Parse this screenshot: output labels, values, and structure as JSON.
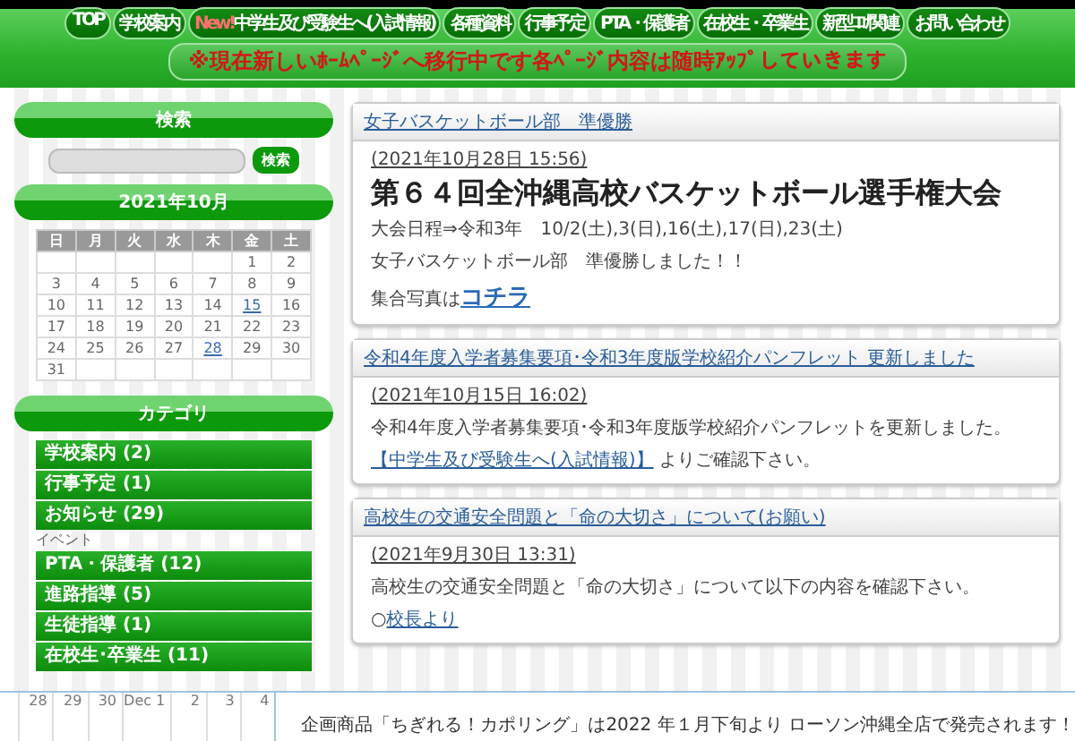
{
  "nav": [
    {
      "label": "TOP"
    },
    {
      "label": "学校案内"
    },
    {
      "badge": "New!",
      "label": "中学生及び受験生へ(入試情報)"
    },
    {
      "label": "各種資料"
    },
    {
      "label": "行事予定"
    },
    {
      "label": "PTA・保護者"
    },
    {
      "label": "在校生・卒業生"
    },
    {
      "label": "新型ｺﾛﾅ関連"
    },
    {
      "label": "お問い合わせ"
    }
  ],
  "notice": "※現在新しいﾎｰﾑﾍﾟｰｼﾞへ移行中です各ﾍﾟｰｼﾞ内容は随時ｱｯﾌﾟしていきます",
  "sidebar": {
    "search": {
      "title": "検索",
      "button": "検索"
    },
    "calendar": {
      "title": "2021年10月",
      "weekdays": [
        "日",
        "月",
        "火",
        "水",
        "木",
        "金",
        "土"
      ],
      "weeks": [
        [
          {
            "day": "1",
            "linked": false
          },
          {
            "day": "2",
            "linked": false
          }
        ],
        [
          {
            "day": "3",
            "linked": false
          },
          {
            "day": "4",
            "linked": false
          },
          {
            "day": "5",
            "linked": false
          },
          {
            "day": "6",
            "linked": false
          },
          {
            "day": "7",
            "linked": false
          },
          {
            "day": "8",
            "linked": false
          },
          {
            "day": "9",
            "linked": false
          }
        ],
        [
          {
            "day": "10",
            "linked": false
          },
          {
            "day": "11",
            "linked": false
          },
          {
            "day": "12",
            "linked": false
          },
          {
            "day": "13",
            "linked": false
          },
          {
            "day": "14",
            "linked": false
          },
          {
            "day": "15",
            "linked": true
          },
          {
            "day": "16",
            "linked": false
          }
        ],
        [
          {
            "day": "17",
            "linked": false
          },
          {
            "day": "18",
            "linked": false
          },
          {
            "day": "19",
            "linked": false
          },
          {
            "day": "20",
            "linked": false
          },
          {
            "day": "21",
            "linked": false
          },
          {
            "day": "22",
            "linked": false
          },
          {
            "day": "23",
            "linked": false
          }
        ],
        [
          {
            "day": "24",
            "linked": false
          },
          {
            "day": "25",
            "linked": false
          },
          {
            "day": "26",
            "linked": false
          },
          {
            "day": "27",
            "linked": false
          },
          {
            "day": "28",
            "linked": true
          },
          {
            "day": "29",
            "linked": false
          },
          {
            "day": "30",
            "linked": false
          }
        ],
        [
          {
            "day": "31",
            "linked": false
          }
        ]
      ]
    },
    "categories": {
      "title": "カテゴリ",
      "items": [
        {
          "kind": "button",
          "label": "学校案内 (2)"
        },
        {
          "kind": "button",
          "label": "行事予定 (1)"
        },
        {
          "kind": "button",
          "label": "お知らせ (29)"
        },
        {
          "kind": "plain",
          "label": "イベント"
        },
        {
          "kind": "button",
          "label": "PTA・保護者 (12)"
        },
        {
          "kind": "button",
          "label": "進路指導 (5)"
        },
        {
          "kind": "button",
          "label": "生徒指導 (1)"
        },
        {
          "kind": "button",
          "label": "在校生･卒業生 (11)"
        }
      ]
    }
  },
  "articles": [
    {
      "title": "女子バスケットボール部　準優勝",
      "date": "(2021年10月28日 15:56)",
      "body": [
        {
          "kind": "heading",
          "parts": [
            {
              "kind": "text",
              "text": "第６４回全沖縄高校バスケットボール選手権大会"
            }
          ]
        },
        {
          "kind": "text",
          "parts": [
            {
              "kind": "text",
              "text": "大会日程⇒令和3年　10/2(土),3(日),16(土),17(日),23(土)"
            }
          ]
        },
        {
          "kind": "text",
          "parts": [
            {
              "kind": "text",
              "text": "女子バスケットボール部　準優勝しました！！"
            }
          ]
        },
        {
          "kind": "text",
          "parts": [
            {
              "kind": "text",
              "text": "集合写真は"
            },
            {
              "kind": "big-link",
              "text": "コチラ"
            }
          ]
        }
      ]
    },
    {
      "title": "令和4年度入学者募集要項･令和3年度版学校紹介パンフレット 更新しました",
      "date": "(2021年10月15日 16:02)",
      "body": [
        {
          "kind": "text",
          "parts": [
            {
              "kind": "text",
              "text": "令和4年度入学者募集要項･令和3年度版学校紹介パンフレットを更新しました。"
            }
          ]
        },
        {
          "kind": "text",
          "parts": [
            {
              "kind": "link",
              "text": "【中学生及び受験生へ(入試情報)】"
            },
            {
              "kind": "text",
              "text": " よりご確認下さい。"
            }
          ]
        }
      ]
    },
    {
      "title": "高校生の交通安全問題と「命の大切さ」について(お願い)",
      "date": "(2021年9月30日 13:31)",
      "body": [
        {
          "kind": "text",
          "parts": [
            {
              "kind": "text",
              "text": "高校生の交通安全問題と「命の大切さ」について以下の内容を確認下さい。"
            }
          ]
        },
        {
          "kind": "text",
          "parts": [
            {
              "kind": "text",
              "text": "○"
            },
            {
              "kind": "link",
              "text": "校長より"
            }
          ]
        }
      ]
    }
  ],
  "overlay": {
    "days": [
      "28",
      "29",
      "30",
      "Dec 1",
      "2",
      "3",
      "4"
    ],
    "text": "企画商品「ちぎれる！カポリング」は2022 年１月下旬より ローソン沖縄全店で発売されます！"
  }
}
